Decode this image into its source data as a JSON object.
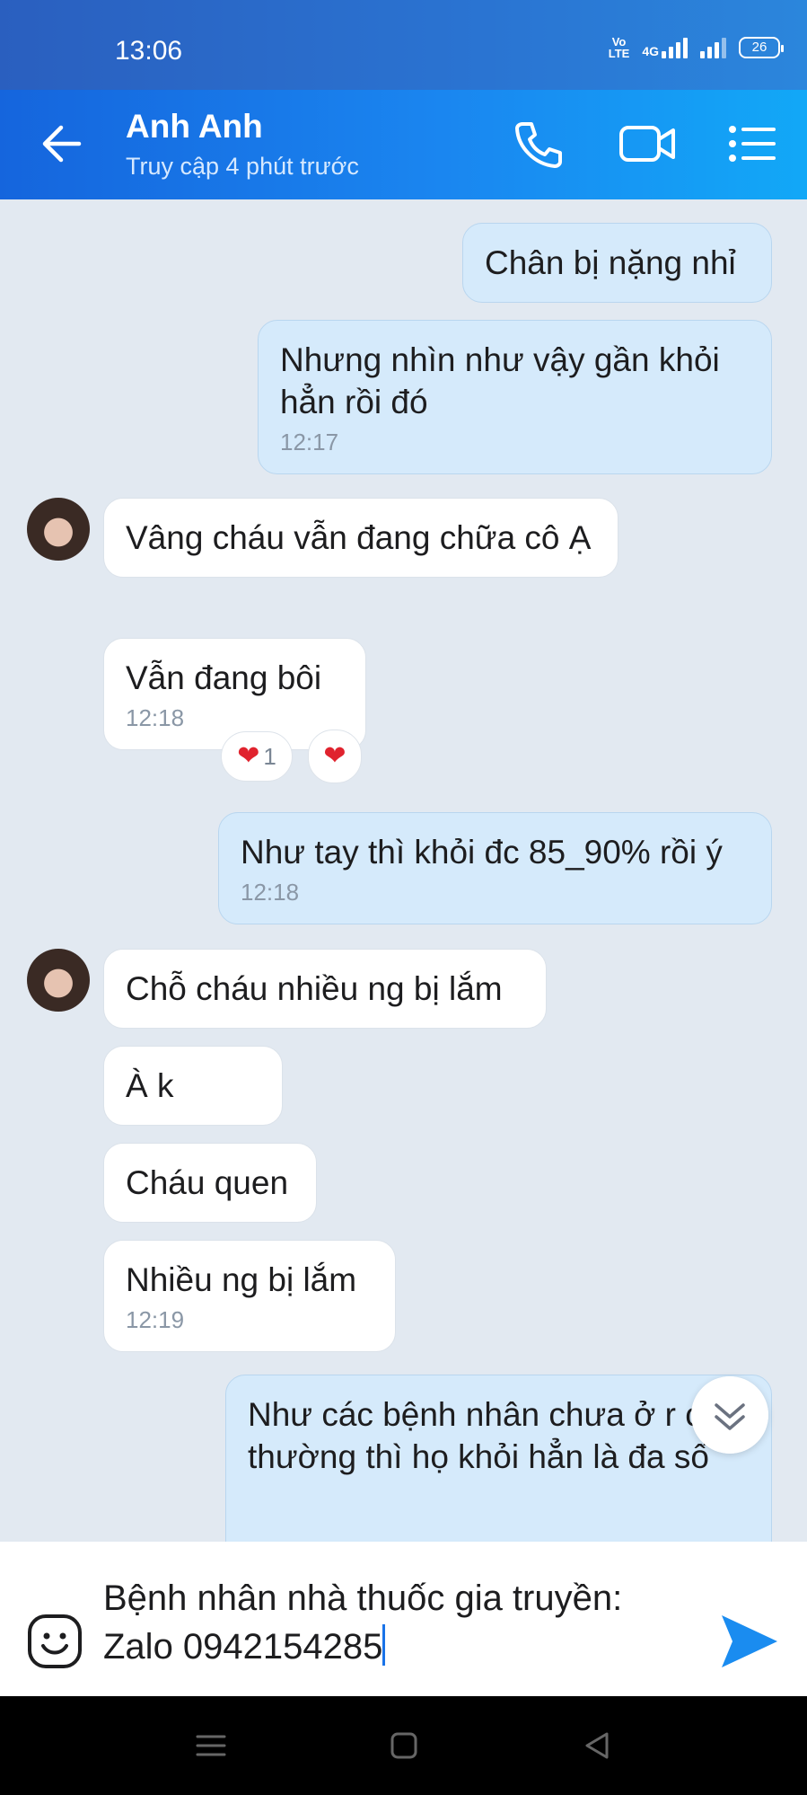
{
  "status_bar": {
    "time": "13:06",
    "volte": "Vo LTE",
    "network": "4G",
    "battery": "26"
  },
  "header": {
    "contact_name": "Anh Anh",
    "contact_status": "Truy cập 4 phút trước"
  },
  "messages": [
    {
      "dir": "out",
      "text": "Chân bị nặng nhỉ"
    },
    {
      "dir": "out",
      "text": "Nhưng nhìn như vậy gần khỏi hẳn rồi đó",
      "time": "12:17"
    },
    {
      "dir": "in",
      "text": "Vâng cháu vẫn đang chữa cô Ạ"
    },
    {
      "dir": "in",
      "text": "Vẫn đang bôi",
      "time": "12:18",
      "reaction_count": "1"
    },
    {
      "dir": "out",
      "text": "Như tay thì khỏi đc 85_90% rồi ý",
      "time": "12:18"
    },
    {
      "dir": "in",
      "text": "Chỗ cháu nhiều ng bị lắm"
    },
    {
      "dir": "in",
      "text": "À k"
    },
    {
      "dir": "in",
      "text": "Cháu quen"
    },
    {
      "dir": "in",
      "text": "Nhiều ng bị lắm",
      "time": "12:19"
    },
    {
      "dir": "out",
      "text": "Như các bệnh nhân chưa ở r cô thường thì họ khỏi hẳn là đa số"
    }
  ],
  "composer": {
    "value": "Bệnh nhân nhà thuốc gia truyền: Zalo 0942154285"
  },
  "colors": {
    "header_accent": "#1a86f0",
    "outgoing_bubble": "#d5eafb",
    "incoming_bubble": "#ffffff",
    "send_button": "#1a8cf0",
    "reaction_heart": "#e0232e"
  },
  "icons": [
    "back-arrow-icon",
    "phone-icon",
    "video-call-icon",
    "menu-list-icon",
    "chevron-double-down-icon",
    "emoji-icon",
    "send-icon",
    "heart-icon",
    "nav-menu-icon",
    "nav-home-icon",
    "nav-back-icon"
  ]
}
